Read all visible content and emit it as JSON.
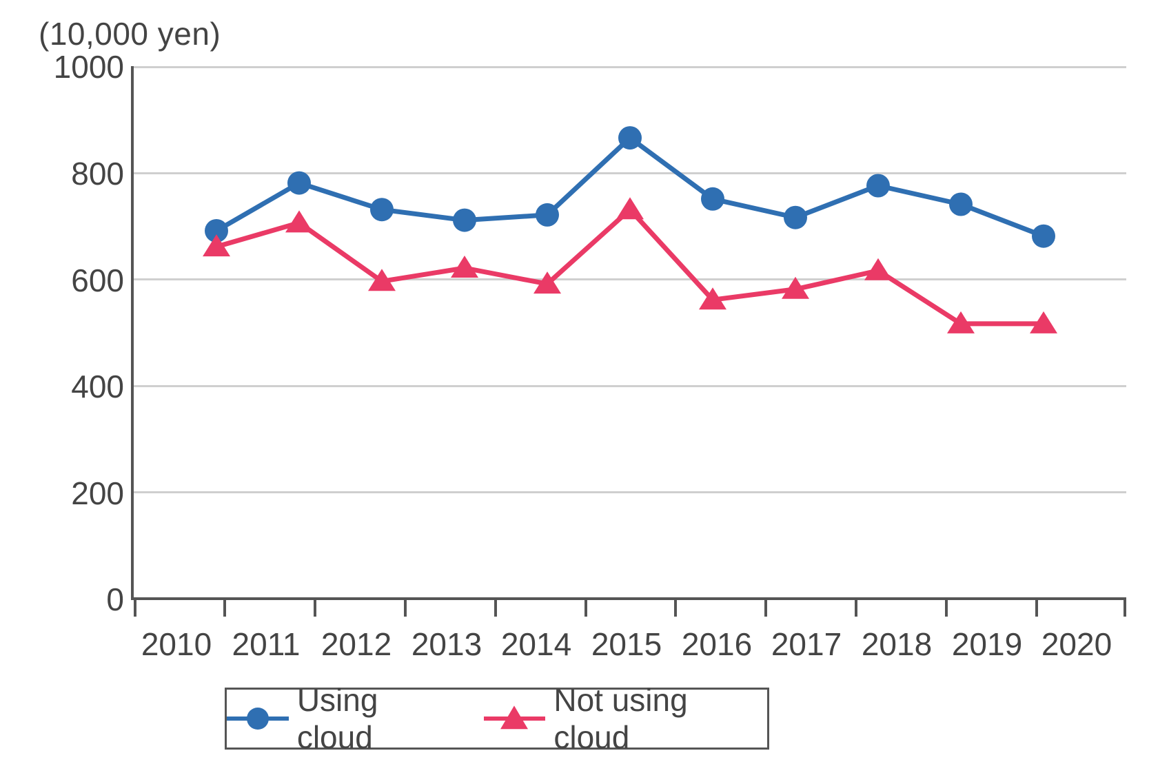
{
  "chart_data": {
    "type": "line",
    "title": "",
    "y_unit_label": "(10,000 yen)",
    "xlabel": "",
    "ylabel": "",
    "ylim": [
      0,
      1000
    ],
    "y_ticks": [
      0,
      200,
      400,
      600,
      800,
      1000
    ],
    "categories": [
      "2010",
      "2011",
      "2012",
      "2013",
      "2014",
      "2015",
      "2016",
      "2017",
      "2018",
      "2019",
      "2020"
    ],
    "series": [
      {
        "name": "Using cloud",
        "color": "#2f6fb2",
        "marker": "circle",
        "values": [
          690,
          780,
          730,
          710,
          720,
          865,
          750,
          715,
          775,
          740,
          680
        ]
      },
      {
        "name": "Not using cloud",
        "color": "#ea3a66",
        "marker": "triangle",
        "values": [
          660,
          705,
          595,
          620,
          590,
          730,
          560,
          580,
          615,
          515,
          515
        ]
      }
    ],
    "legend_position": "bottom"
  }
}
